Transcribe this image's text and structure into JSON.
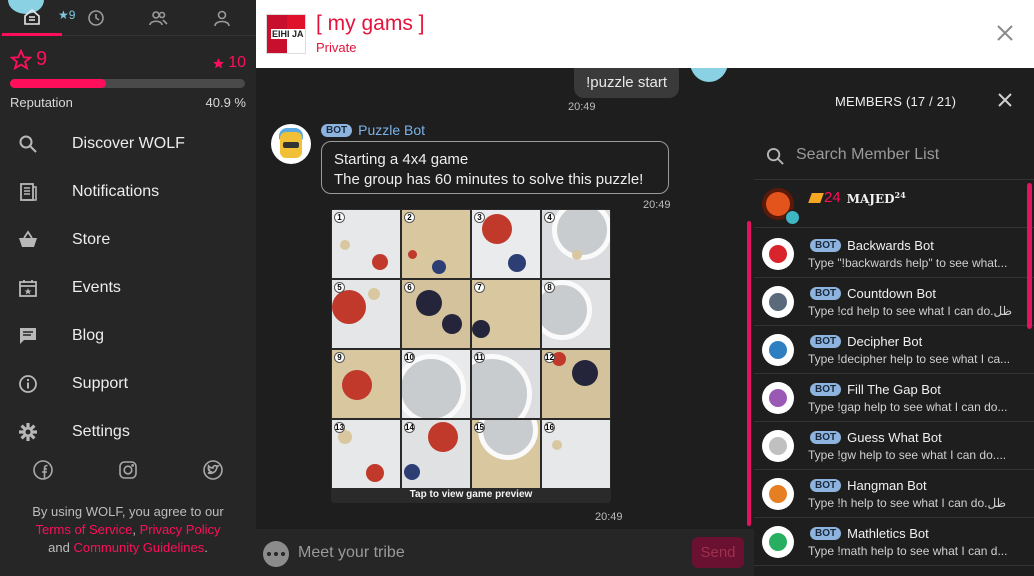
{
  "sidebar": {
    "top_badge": "9",
    "reputation": {
      "level": "9",
      "next_level": "10",
      "label": "Reputation",
      "percent_text": "40.9 %",
      "progress": 0.409
    },
    "menu": [
      {
        "label": "Discover WOLF",
        "icon": "search-icon"
      },
      {
        "label": "Notifications",
        "icon": "notifications-icon"
      },
      {
        "label": "Store",
        "icon": "basket-icon"
      },
      {
        "label": "Events",
        "icon": "calendar-icon"
      },
      {
        "label": "Blog",
        "icon": "chat-bubble-icon"
      },
      {
        "label": "Support",
        "icon": "info-icon"
      },
      {
        "label": "Settings",
        "icon": "gear-icon"
      }
    ],
    "legal": {
      "prefix": "By using WOLF, you agree to our",
      "terms": "Terms of Service",
      "comma": ",",
      "privacy": "Privacy Policy",
      "and": "and",
      "guidelines": "Community Guidelines",
      "period": "."
    }
  },
  "header": {
    "group_name": "[ my gams ]",
    "privacy": "Private",
    "group_icon_text": "EIHI JA"
  },
  "chat": {
    "my_message": "!puzzle start",
    "my_time": "20:49",
    "bot_tag": "BOT",
    "bot_name": "Puzzle Bot",
    "bot_line1": "Starting a 4x4 game",
    "bot_line2": "The group has 60 minutes to solve this puzzle!",
    "bot_time1": "20:49",
    "puzzle_numbers": [
      "1",
      "2",
      "3",
      "4",
      "5",
      "6",
      "7",
      "8",
      "9",
      "10",
      "11",
      "12",
      "13",
      "14",
      "15",
      "16"
    ],
    "puzzle_caption": "Tap to view game preview",
    "bot_time2": "20:49"
  },
  "input": {
    "placeholder": "Meet your tribe",
    "send_label": "Send"
  },
  "members": {
    "title": "MEMBERS (17 / 21)",
    "search_placeholder": "Search Member List",
    "owner": {
      "level": "24",
      "name": "MAJED",
      "name_sup": "24"
    },
    "bots": [
      {
        "tag": "BOT",
        "name": "Backwards Bot",
        "desc": "Type \"!backwards help\" to see what...",
        "color": "#d9232d"
      },
      {
        "tag": "BOT",
        "name": "Countdown Bot",
        "desc": "Type !cd help to see what I can do.ظل",
        "color": "#5b6a7a"
      },
      {
        "tag": "BOT",
        "name": "Decipher Bot",
        "desc": "Type !decipher help to see what I ca...",
        "color": "#2d7fc1"
      },
      {
        "tag": "BOT",
        "name": "Fill The Gap Bot",
        "desc": "Type !gap help to see what I can do...",
        "color": "#9b59b6"
      },
      {
        "tag": "BOT",
        "name": "Guess What Bot",
        "desc": "Type !gw help to see what I can do....",
        "color": "#c0c0c0"
      },
      {
        "tag": "BOT",
        "name": "Hangman Bot",
        "desc": "Type !h help to see what I can do.ظل",
        "color": "#e67e22"
      },
      {
        "tag": "BOT",
        "name": "Mathletics Bot",
        "desc": "Type !math help to see what I can d...",
        "color": "#27ae60"
      }
    ]
  },
  "colors": {
    "accent": "#ff0f5b",
    "bot_tag": "#8db4df",
    "bot_name": "#7cb3e8"
  }
}
